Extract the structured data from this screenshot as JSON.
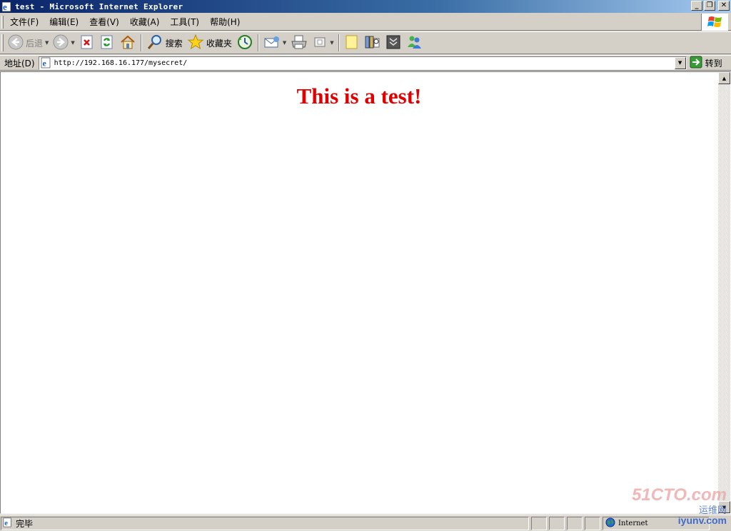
{
  "window": {
    "title": "test - Microsoft Internet Explorer",
    "minimize_glyph": "_",
    "restore_glyph": "❐",
    "close_glyph": "✕"
  },
  "menu": {
    "items": [
      {
        "label": "文件(F)"
      },
      {
        "label": "编辑(E)"
      },
      {
        "label": "查看(V)"
      },
      {
        "label": "收藏(A)"
      },
      {
        "label": "工具(T)"
      },
      {
        "label": "帮助(H)"
      }
    ]
  },
  "toolbar": {
    "back_label": "后退",
    "search_label": "搜索",
    "favorites_label": "收藏夹",
    "icons": [
      "back-icon",
      "forward-icon",
      "stop-icon",
      "refresh-icon",
      "home-icon",
      "search-icon",
      "favorites-icon",
      "history-icon",
      "mail-icon",
      "print-icon",
      "edit-icon",
      "discuss-icon",
      "research-icon",
      "media-icon",
      "messenger-icon"
    ]
  },
  "address": {
    "label": "地址(D)",
    "url": "http://192.168.16.177/mysecret/",
    "go_label": "转到"
  },
  "page": {
    "heading": "This is a test!",
    "heading_color": "#e00000"
  },
  "status": {
    "text": "完毕",
    "zone": "Internet"
  },
  "watermark": {
    "line1": "51CTO.com",
    "line2": "运维网",
    "line3": "iyunv.com"
  }
}
